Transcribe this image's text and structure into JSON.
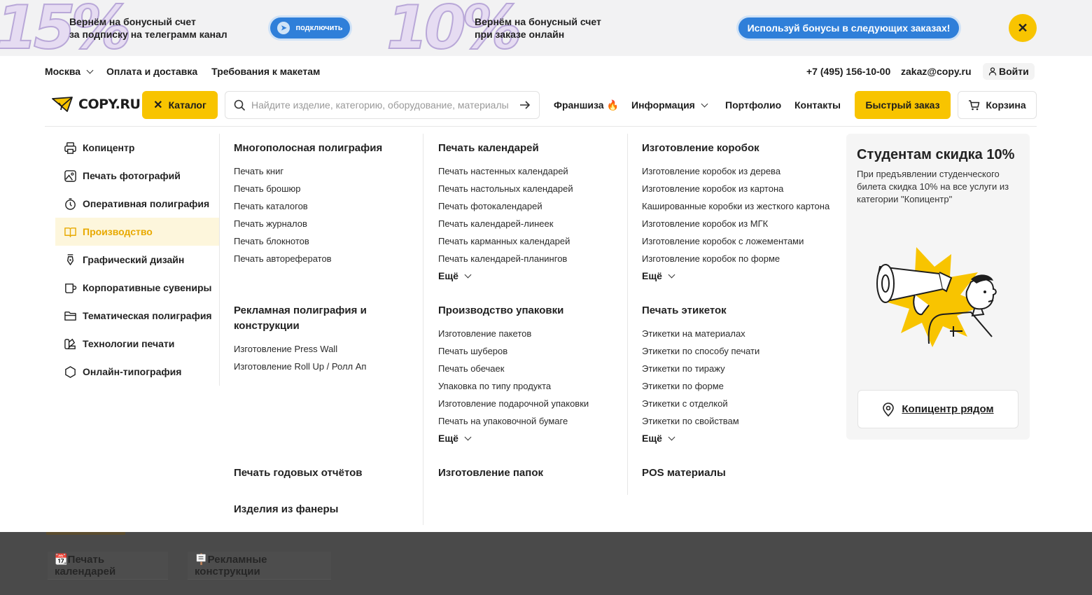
{
  "promo": {
    "pct1": "15%",
    "text1_line1": "Вернём на бонусный счет",
    "text1_line2": "за подписку на телеграмм канал",
    "btn1": "подключить",
    "pct2": "10%",
    "text2_line1": "Вернём на бонусный счет",
    "text2_line2": "при заказе онлайн",
    "btn2": "Используй бонусы в следующих заказах!",
    "close": "✕"
  },
  "topbar": {
    "city": "Москва",
    "payment": "Оплата и доставка",
    "requirements": "Требования к макетам",
    "phone": "+7 (495) 156-10-00",
    "email": "zakaz@copy.ru",
    "login": "Войти"
  },
  "header": {
    "logo": "COPY.RU",
    "catalog": "Каталог",
    "search_placeholder": "Найдите изделие, категорию, оборудование, материалы",
    "franchise": "Франшиза 🔥",
    "info": "Информация",
    "portfolio": "Портфолио",
    "contacts": "Контакты",
    "quick_order": "Быстрый заказ",
    "cart": "Корзина"
  },
  "sidebar": [
    {
      "label": "Копицентр",
      "icon": "printer-icon"
    },
    {
      "label": "Печать фотографий",
      "icon": "image-icon"
    },
    {
      "label": "Оперативная полиграфия",
      "icon": "timer-icon"
    },
    {
      "label": "Производство",
      "icon": "book-icon"
    },
    {
      "label": "Графический дизайн",
      "icon": "pen-nib-icon"
    },
    {
      "label": "Корпоративные сувениры",
      "icon": "mug-icon"
    },
    {
      "label": "Тематическая полиграфия",
      "icon": "folder-icon"
    },
    {
      "label": "Технологии печати",
      "icon": "swatch-icon"
    },
    {
      "label": "Онлайн-типография",
      "icon": "hexagon-icon"
    }
  ],
  "sections": {
    "multipage": {
      "title": "Многополосная полиграфия",
      "items": [
        "Печать книг",
        "Печать брошюр",
        "Печать каталогов",
        "Печать журналов",
        "Печать блокнотов",
        "Печать авторефератов"
      ]
    },
    "advert": {
      "title": "Рекламная полиграфия и конструкции",
      "items": [
        "Изготовление Press Wall",
        "Изготовление Roll Up / Ролл Ап"
      ]
    },
    "annual": {
      "title": "Печать годовых отчётов"
    },
    "plywood": {
      "title": "Изделия из фанеры"
    },
    "calendars": {
      "title": "Печать календарей",
      "items": [
        "Печать настенных календарей",
        "Печать настольных календарей",
        "Печать фотокалендарей",
        "Печать календарей-линеек",
        "Печать карманных календарей",
        "Печать календарей-планингов"
      ],
      "more": "Ещё"
    },
    "packaging": {
      "title": "Производство упаковки",
      "items": [
        "Изготовление пакетов",
        "Печать шуберов",
        "Печать обечаек",
        "Упаковка по типу продукта",
        "Изготовление подарочной упаковки",
        "Печать на упаковочной бумаге"
      ],
      "more": "Ещё"
    },
    "folders": {
      "title": "Изготовление папок"
    },
    "boxes": {
      "title": "Изготовление коробок",
      "items": [
        "Изготовление коробок из дерева",
        "Изготовление коробок из картона",
        "Кашированные коробки из жесткого картона",
        "Изготовление коробок из МГК",
        "Изготовление коробок с ложементами",
        "Изготовление коробок по форме"
      ],
      "more": "Ещё"
    },
    "labels": {
      "title": "Печать этикеток",
      "items": [
        "Этикетки на материалах",
        "Этикетки по способу печати",
        "Этикетки по тиражу",
        "Этикетки по форме",
        "Этикетки с отделкой",
        "Этикетки по свойствам"
      ],
      "more": "Ещё"
    },
    "pos": {
      "title": "POS материалы"
    }
  },
  "promo_card": {
    "title": "Студентам скидка 10%",
    "text": "При предъявлении студенческого билета скидка 10% на все услуги из категории \"Копицентр\"",
    "near_button": "Копицентр рядом"
  },
  "background_tabs": {
    "tab1": "📆Печать календарей",
    "tab2": "🪧Рекламные конструкции"
  },
  "colors": {
    "accent": "#f8c400",
    "active_text": "#e8a900",
    "blue": "#2f7fd9"
  }
}
